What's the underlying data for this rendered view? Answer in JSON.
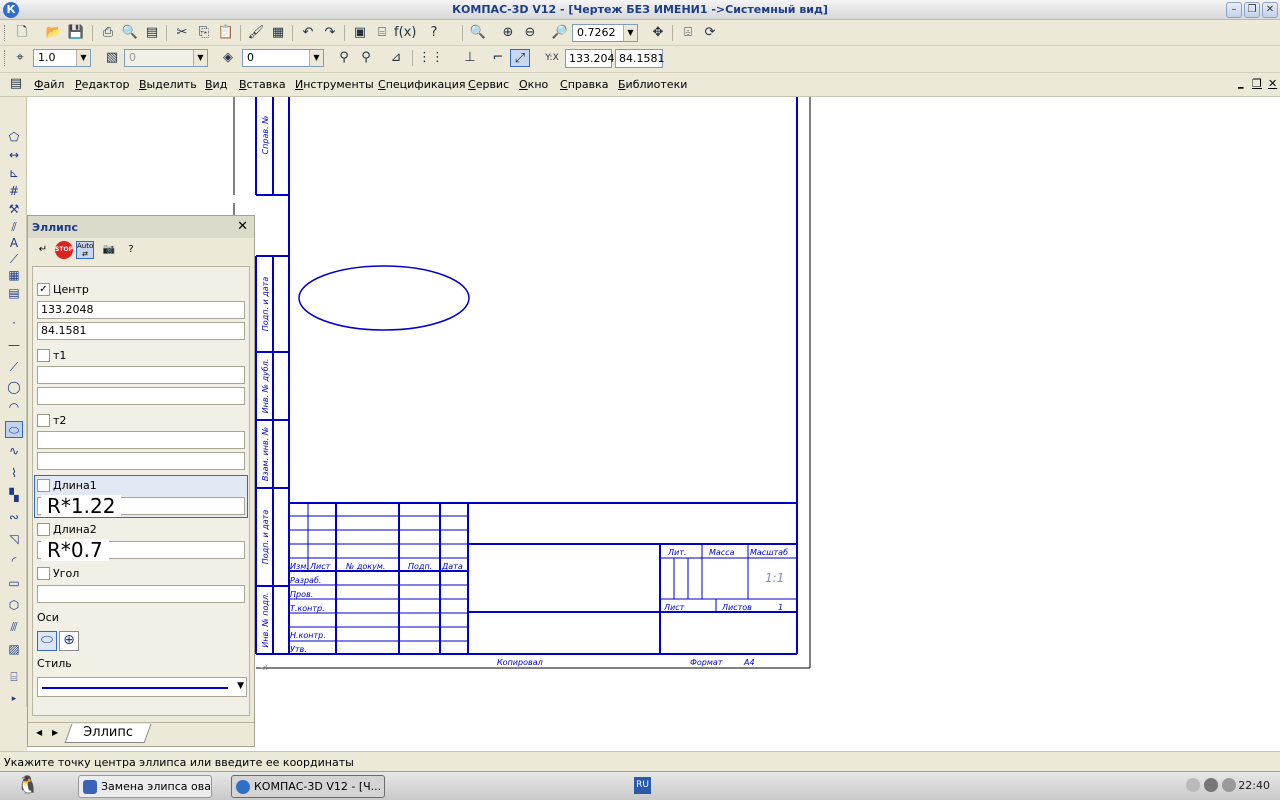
{
  "window": {
    "title": "КОМПАС-3D V12 - [Чертеж БЕЗ ИМЕНИ1 ->Системный вид]",
    "app_icon": "К"
  },
  "toolbar_standard": {
    "zoom": "0.7262"
  },
  "toolbar_current_state": {
    "step": "1.0",
    "layer_disabled": "0",
    "style_layer": "0",
    "coord_x": "133.204",
    "coord_y": "84.1581"
  },
  "menu": [
    "Файл",
    "Редактор",
    "Выделить",
    "Вид",
    "Вставка",
    "Инструменты",
    "Спецификация",
    "Сервис",
    "Окно",
    "Справка",
    "Библиотеки"
  ],
  "panel": {
    "title": "Эллипс",
    "center_label": "Центр",
    "center_x": "133.2048",
    "center_y": "84.1581",
    "t1_label": "т1",
    "t2_label": "т2",
    "length1_label": "Длина1",
    "length1_value": "R*1.22",
    "length2_label": "Длина2",
    "length2_value": "R*0.7",
    "angle_label": "Угол",
    "axes_label": "Оси",
    "style_label": "Стиль",
    "tab_label": "Эллипс"
  },
  "drawing": {
    "side_labels": [
      "Справ. №",
      "Подп. и дата",
      "Инв. № дубл.",
      "Взам. инв. №",
      "Подп. и дата",
      "Инв. № подл."
    ],
    "title_block_headers": [
      "Изм.",
      "Лист",
      "№ докум.",
      "Подп.",
      "Дата"
    ],
    "title_block_rows": [
      "Разраб.",
      "Пров.",
      "Т.контр.",
      "Н.контр.",
      "Утв."
    ],
    "lit_label": "Лит.",
    "mass_label": "Масса",
    "scale_label": "Масштаб",
    "scale_value": "1:1",
    "sheet_label": "Лист",
    "sheets_label": "Листов",
    "sheets_value": "1",
    "copied_label": "Копировал",
    "format_label": "Формат",
    "format_value": "A4",
    "line_color": "#0000c8"
  },
  "status": {
    "text": "Укажите точку центра эллипса или введите ее координаты"
  },
  "taskbar": {
    "tasks": [
      "Замена элипса ова...",
      "КОМПАС-3D V12 - [Ч..."
    ],
    "lang": "RU",
    "clock": "22:40"
  }
}
